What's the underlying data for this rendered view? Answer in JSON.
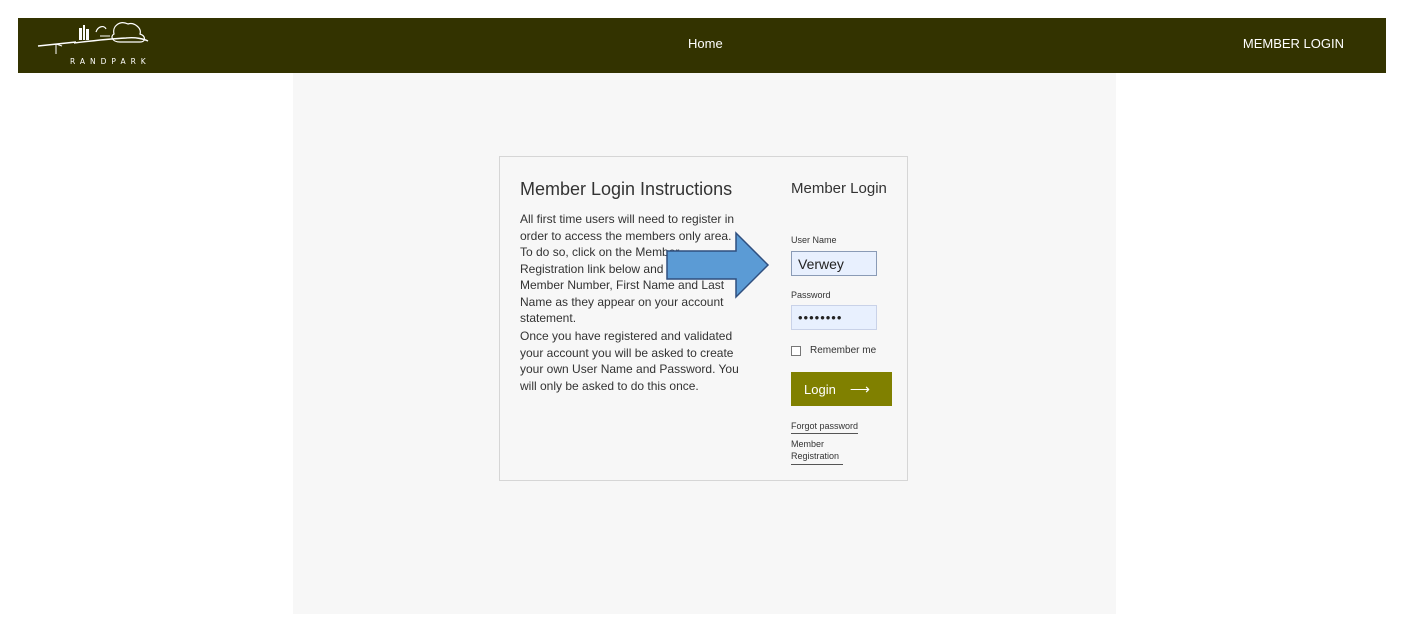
{
  "header": {
    "logo_text": "RANDPARK",
    "nav_home": "Home",
    "nav_member_login": "MEMBER LOGIN"
  },
  "instructions": {
    "title": "Member Login Instructions",
    "paragraph1": "All first time users will need to register in order to access the members only area. To do so, click on the Member Registration link below and enter your Member Number, First Name and Last Name as they appear on your account statement.",
    "paragraph2": "Once you have registered and validated your account you will be asked to create your own User Name and Password. You will only be asked to do this once."
  },
  "login_form": {
    "title": "Member Login",
    "username_label": "User Name",
    "username_value": "Verwey",
    "password_label": "Password",
    "password_value": "••••••••",
    "remember_label": "Remember me",
    "login_button": "Login",
    "forgot_password_link": "Forgot password",
    "registration_link": "Member Registration"
  },
  "colors": {
    "header_bg": "#333300",
    "button_bg": "#808000",
    "arrow_fill": "#5b9bd5"
  },
  "icons": {
    "login_arrow": "right-arrow-icon",
    "annotation": "blue-arrow-icon"
  }
}
